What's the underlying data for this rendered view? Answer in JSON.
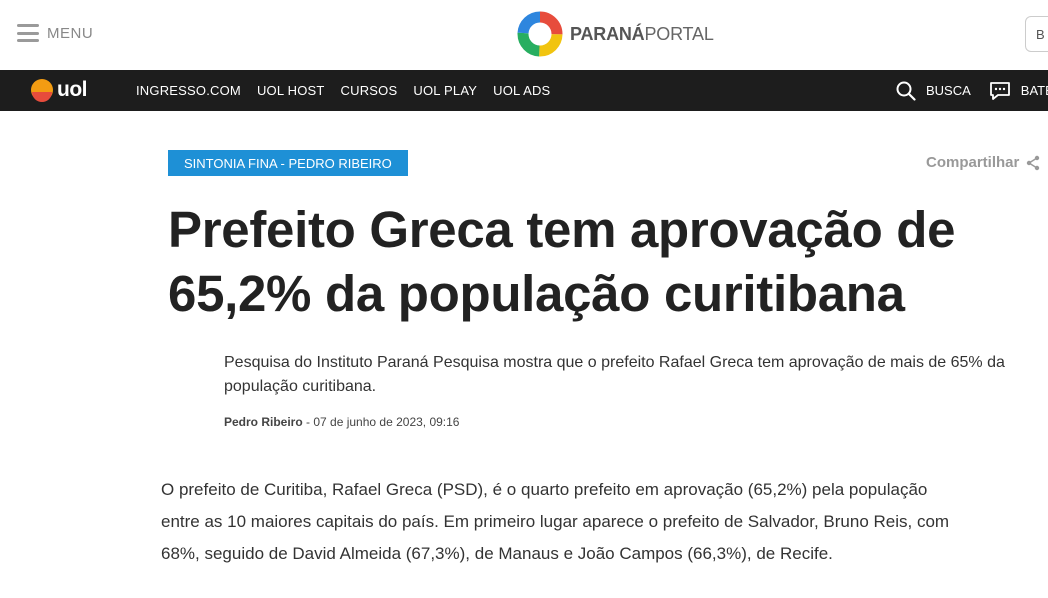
{
  "header": {
    "menu_label": "MENU",
    "logo_part1": "PARANÁ",
    "logo_part2": "PORTAL",
    "search_placeholder": "B"
  },
  "uol_bar": {
    "logo_text": "uol",
    "nav": [
      "INGRESSO.COM",
      "UOL HOST",
      "CURSOS",
      "UOL PLAY",
      "UOL ADS"
    ],
    "search_label": "BUSCA",
    "chat_label": "BATE"
  },
  "article": {
    "section_badge": "SINTONIA FINA - PEDRO RIBEIRO",
    "share_label": "Compartilhar",
    "title": "Prefeito Greca tem aprovação de 65,2% da população curitibana",
    "subtitle": "Pesquisa do Instituto Paraná Pesquisa mostra que o prefeito Rafael Greca tem aprovação de mais de 65% da população curitibana.",
    "author": "Pedro Ribeiro",
    "date": " - 07 de junho de 2023, 09:16",
    "body": "O prefeito de Curitiba, Rafael Greca (PSD), é o quarto prefeito em aprovação (65,2%) pela população entre as 10 maiores capitais do país. Em primeiro lugar aparece o prefeito de Salvador, Bruno Reis, com 68%, seguido de David Almeida (67,3%), de Manaus e João Campos (66,3%), de Recife."
  },
  "colors": {
    "badge": "#1e90d6",
    "uol_bar": "#1d1d1d"
  }
}
